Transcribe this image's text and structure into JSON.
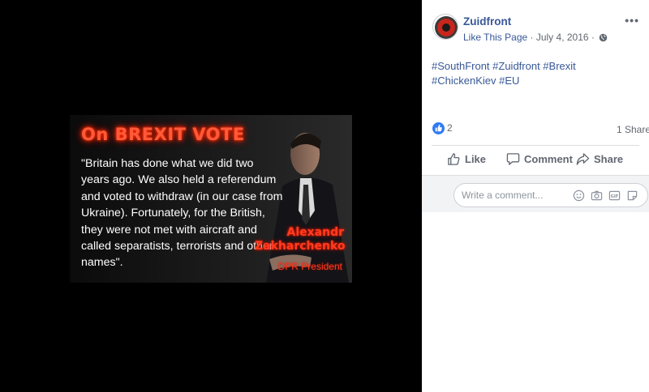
{
  "image": {
    "title": "On BREXIT VOTE",
    "quote": "\"Britain has done what we did two years ago. We also held a referendum and voted to withdraw (in our case from Ukraine).  Fortunately, for the British, they were not met with aircraft and called separatists, terrorists and other names\".",
    "name_first": "Alexandr",
    "name_last": "Zakharchenko",
    "role": "DPR President"
  },
  "post": {
    "page_name": "Zuidfront",
    "like_page": "Like This Page",
    "separator": " · ",
    "date": "July 4, 2016",
    "hashtags": "#SouthFront #Zuidfront #Brexit #ChickenKiev #EU",
    "reaction_count": "2",
    "share_count": "1 Share",
    "more": "•••"
  },
  "actions": {
    "like": "Like",
    "comment": "Comment",
    "share": "Share"
  },
  "comment_box": {
    "placeholder": "Write a comment..."
  },
  "colors": {
    "link": "#385898",
    "secondary_text": "#616770",
    "like_blue": "#2f7bf6",
    "image_title_red": "#ff5a3a"
  },
  "icons": {
    "globe": "globe-icon",
    "like_reaction": "thumbs-up-icon",
    "emoji": "emoji-icon",
    "camera": "camera-icon",
    "gif": "gif-icon",
    "sticker": "sticker-icon"
  }
}
